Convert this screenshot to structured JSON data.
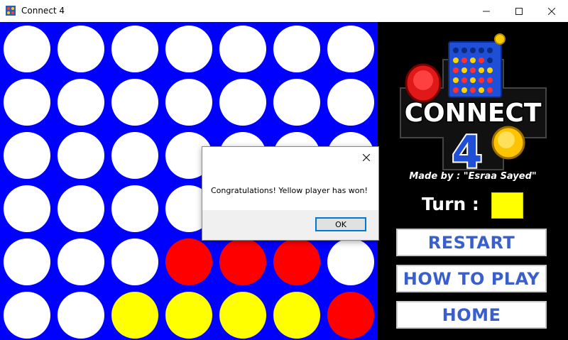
{
  "window": {
    "title": "Connect 4",
    "controls": [
      "minimize",
      "maximize",
      "close"
    ]
  },
  "board": {
    "rows": 6,
    "columns": 7,
    "colors": {
      "board": "#0000ff",
      "empty": "#ffffff",
      "red": "#ff0000",
      "yellow": "#ffff00"
    },
    "cells": [
      [
        "empty",
        "empty",
        "empty",
        "empty",
        "empty",
        "empty",
        "empty"
      ],
      [
        "empty",
        "empty",
        "empty",
        "empty",
        "empty",
        "empty",
        "empty"
      ],
      [
        "empty",
        "empty",
        "empty",
        "empty",
        "empty",
        "empty",
        "empty"
      ],
      [
        "empty",
        "empty",
        "empty",
        "empty",
        "empty",
        "empty",
        "empty"
      ],
      [
        "empty",
        "empty",
        "empty",
        "red",
        "red",
        "red",
        "empty"
      ],
      [
        "empty",
        "empty",
        "yellow",
        "yellow",
        "yellow",
        "yellow",
        "red"
      ]
    ]
  },
  "panel": {
    "logo_text": "CONNECT",
    "logo_number": "4",
    "credit": "Made by : \"Esraa Sayed\"",
    "turn_label": "Turn :",
    "turn_color": "#ffff00",
    "buttons": {
      "restart": "RESTART",
      "how_to_play": "HOW TO PLAY",
      "home": "HOME"
    }
  },
  "dialog": {
    "message": "Congratulations! Yellow player has won!",
    "ok_label": "OK"
  }
}
